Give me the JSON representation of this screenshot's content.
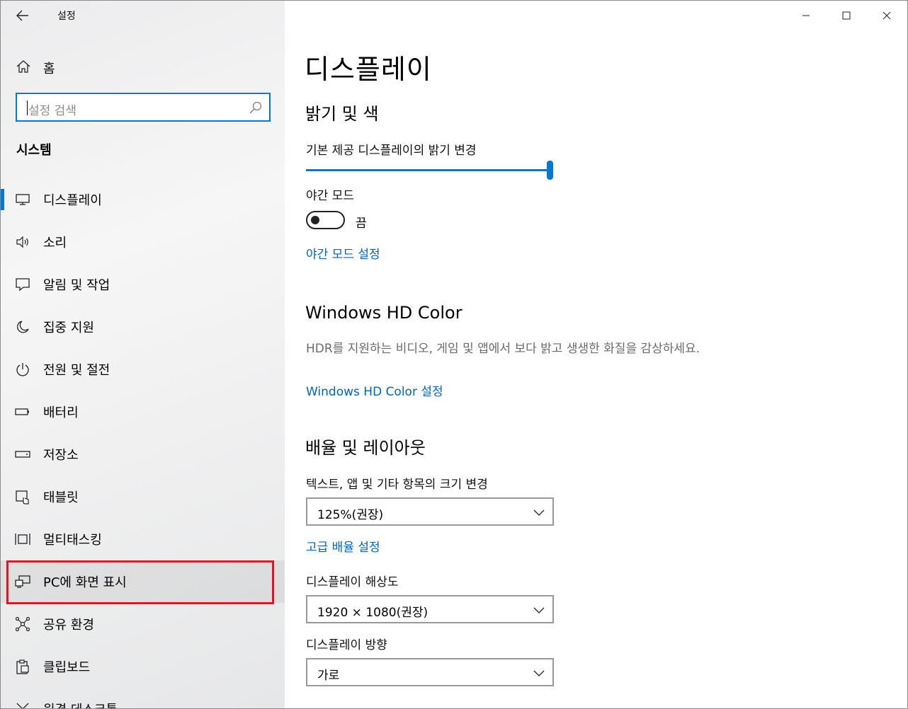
{
  "window": {
    "app_title": "설정"
  },
  "sidebar": {
    "home_label": "홈",
    "search_placeholder": "설정 검색",
    "section_title": "시스템",
    "items": [
      {
        "label": "디스플레이",
        "icon": "monitor-icon"
      },
      {
        "label": "소리",
        "icon": "speaker-icon"
      },
      {
        "label": "알림 및 작업",
        "icon": "notification-icon"
      },
      {
        "label": "집중 지원",
        "icon": "moon-icon"
      },
      {
        "label": "전원 및 절전",
        "icon": "power-icon"
      },
      {
        "label": "배터리",
        "icon": "battery-icon"
      },
      {
        "label": "저장소",
        "icon": "storage-icon"
      },
      {
        "label": "태블릿",
        "icon": "tablet-icon"
      },
      {
        "label": "멀티태스킹",
        "icon": "multitasking-icon"
      },
      {
        "label": "PC에 화면 표시",
        "icon": "project-icon"
      },
      {
        "label": "공유 환경",
        "icon": "share-icon"
      },
      {
        "label": "클립보드",
        "icon": "clipboard-icon"
      },
      {
        "label": "원격 데스크톱",
        "icon": "remote-desktop-icon"
      }
    ]
  },
  "main": {
    "page_title": "디스플레이",
    "brightness_section": "밝기 및 색",
    "brightness_label": "기본 제공 디스플레이의 밝기 변경",
    "brightness_value": 100,
    "night_mode_label": "야간 모드",
    "night_mode_state": "끔",
    "night_mode_link": "야간 모드 설정",
    "hdr_section": "Windows HD Color",
    "hdr_desc": "HDR를 지원하는 비디오, 게임 및 앱에서 보다 밝고 생생한 화질을 감상하세요.",
    "hdr_link": "Windows HD Color 설정",
    "scale_section": "배율 및 레이아웃",
    "scale_label": "텍스트, 앱 및 기타 항목의 크기 변경",
    "scale_value": "125%(권장)",
    "advanced_scale_link": "고급 배율 설정",
    "resolution_label": "디스플레이 해상도",
    "resolution_value": "1920 × 1080(권장)",
    "orientation_label": "디스플레이 방향",
    "orientation_value": "가로"
  },
  "colors": {
    "accent": "#0078d4",
    "link": "#0067b8",
    "highlight": "#e81123"
  }
}
